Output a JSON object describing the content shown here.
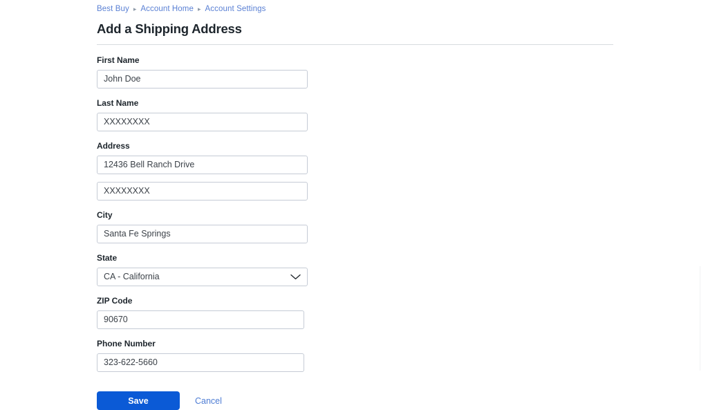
{
  "breadcrumb": {
    "items": [
      {
        "label": "Best Buy"
      },
      {
        "label": "Account Home"
      },
      {
        "label": "Account Settings"
      }
    ],
    "separator": "▸"
  },
  "page": {
    "title": "Add a Shipping Address"
  },
  "form": {
    "first_name": {
      "label": "First Name",
      "value": "John Doe"
    },
    "last_name": {
      "label": "Last Name",
      "value": "XXXXXXXX"
    },
    "address": {
      "label": "Address",
      "line1": "12436 Bell Ranch Drive",
      "line2": "XXXXXXXX"
    },
    "city": {
      "label": "City",
      "value": "Santa Fe Springs"
    },
    "state": {
      "label": "State",
      "value": "CA - California",
      "icon": "chevron-down-icon"
    },
    "zip": {
      "label": "ZIP Code",
      "value": "90670"
    },
    "phone": {
      "label": "Phone Number",
      "value": "323-622-5660"
    }
  },
  "actions": {
    "save_label": "Save",
    "cancel_label": "Cancel"
  },
  "colors": {
    "primary_button": "#0b5ad6",
    "link": "#5a80d4",
    "label_text": "#1d252c",
    "input_border": "#c5cbd5",
    "rule": "#d7dbdf"
  }
}
